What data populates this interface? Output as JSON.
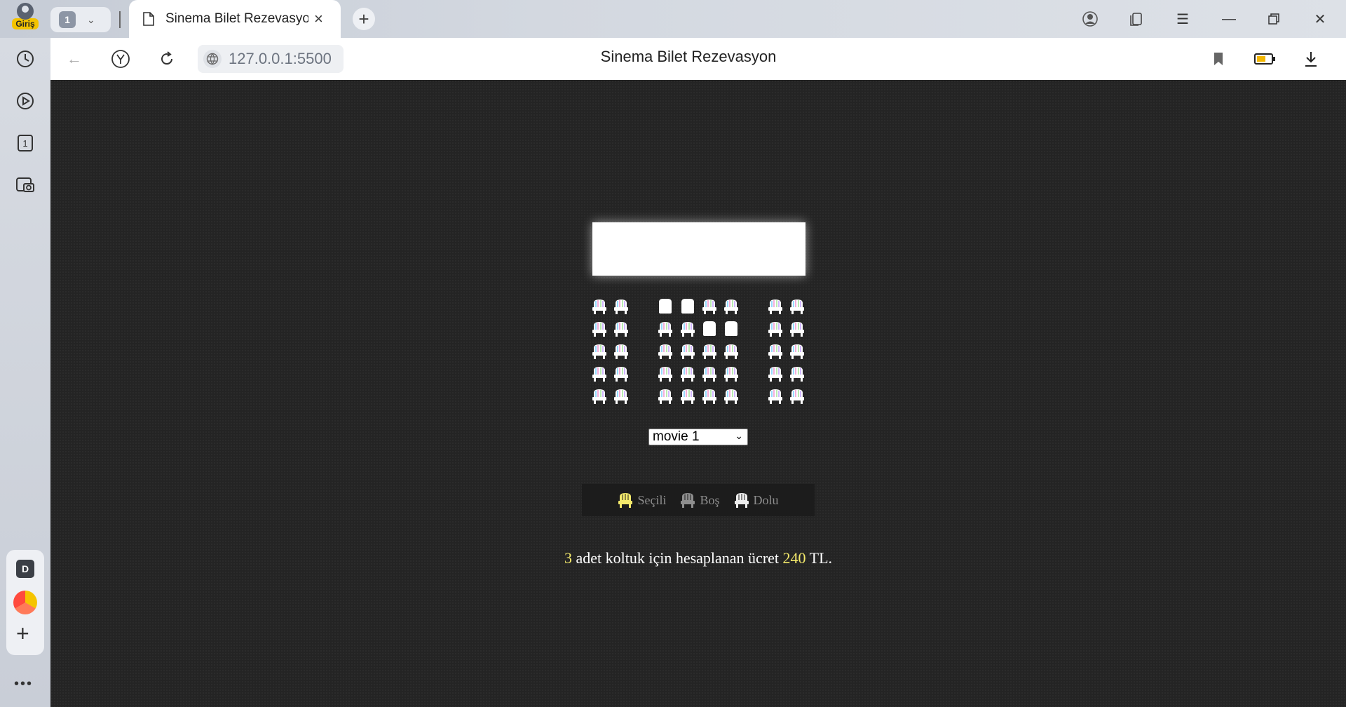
{
  "browser": {
    "profile_label": "Giriş",
    "tab_count": "1",
    "active_tab_title": "Sinema Bilet Rezevasyon",
    "url": "127.0.0.1:5500",
    "page_title": "Sinema Bilet Rezevasyon",
    "sidebar_badge": "D"
  },
  "cinema": {
    "movie_select": {
      "selected": "movie 1"
    },
    "legend": {
      "selected_label": "Seçili",
      "empty_label": "Boş",
      "occupied_label": "Dolu"
    },
    "seat_colors": {
      "available": "#9aa2b1",
      "selected": "#f3e96b",
      "occupied": "#ffffff"
    },
    "seats": [
      [
        "empty",
        "empty",
        "occupied",
        "occupied",
        "empty",
        "empty",
        "empty",
        "empty"
      ],
      [
        "empty",
        "empty",
        "empty",
        "empty",
        "occupied",
        "occupied",
        "empty",
        "empty"
      ],
      [
        "empty",
        "empty",
        "empty",
        "empty",
        "empty",
        "empty",
        "empty",
        "empty"
      ],
      [
        "empty",
        "empty",
        "empty",
        "empty",
        "empty",
        "empty",
        "empty",
        "empty"
      ],
      [
        "empty",
        "empty",
        "empty",
        "empty",
        "empty",
        "empty",
        "empty",
        "empty"
      ]
    ],
    "summary": {
      "count": "3",
      "text_middle": "adet koltuk için hesaplanan ücret",
      "price": "240",
      "currency_suffix": "TL."
    }
  }
}
